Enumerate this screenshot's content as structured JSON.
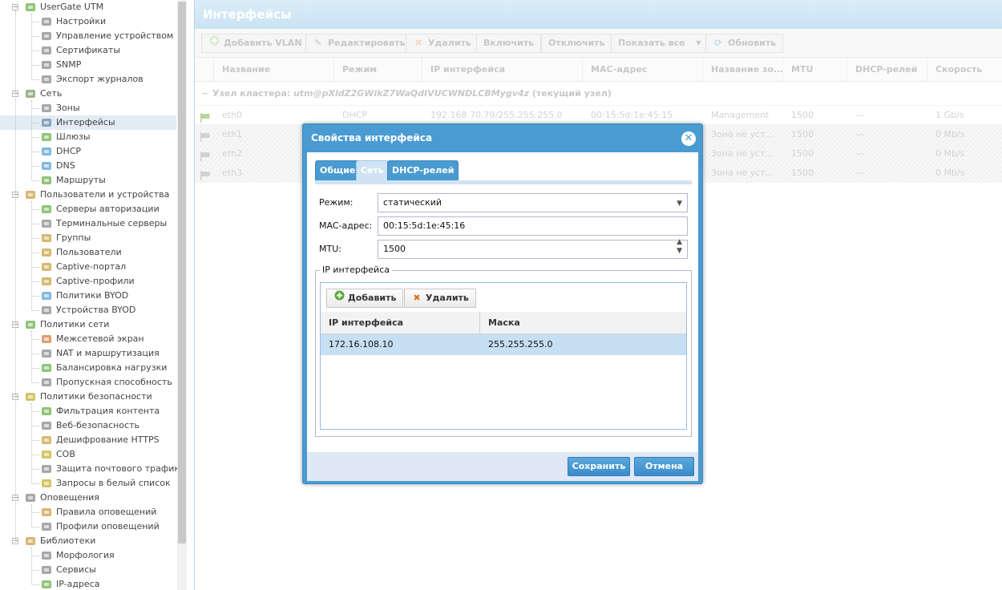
{
  "sidebar": {
    "items": [
      {
        "label": "UserGate UTM",
        "level": 0,
        "icon": "chart-icon",
        "color": "#6ab04c"
      },
      {
        "label": "Настройки",
        "level": 1,
        "icon": "settings-icon",
        "color": "#8a8a8a"
      },
      {
        "label": "Управление устройством",
        "level": 1,
        "icon": "device-icon",
        "color": "#8a8a8a"
      },
      {
        "label": "Сертификаты",
        "level": 1,
        "icon": "certificate-icon",
        "color": "#8a8a8a"
      },
      {
        "label": "SNMP",
        "level": 1,
        "icon": "snmp-icon",
        "color": "#8a8a8a"
      },
      {
        "label": "Экспорт журналов",
        "level": 1,
        "icon": "export-icon",
        "color": "#8a8a8a"
      },
      {
        "label": "Сеть",
        "level": 0,
        "icon": "network-icon",
        "color": "#7a9a6a"
      },
      {
        "label": "Зоны",
        "level": 1,
        "icon": "zones-icon",
        "color": "#8a8a8a"
      },
      {
        "label": "Интерфейсы",
        "level": 1,
        "icon": "interfaces-icon",
        "color": "#6a8aaa"
      },
      {
        "label": "Шлюзы",
        "level": 1,
        "icon": "gateway-icon",
        "color": "#6ab04c"
      },
      {
        "label": "DHCP",
        "level": 1,
        "icon": "dhcp-icon",
        "color": "#5aa0d0"
      },
      {
        "label": "DNS",
        "level": 1,
        "icon": "dns-icon",
        "color": "#5aa0d0"
      },
      {
        "label": "Маршруты",
        "level": 1,
        "icon": "routes-icon",
        "color": "#6ab04c"
      },
      {
        "label": "Пользователи и устройства",
        "level": 0,
        "icon": "users-devices-icon",
        "color": "#c8a040"
      },
      {
        "label": "Серверы авторизации",
        "level": 1,
        "icon": "auth-server-icon",
        "color": "#6ab04c"
      },
      {
        "label": "Терминальные серверы",
        "level": 1,
        "icon": "terminal-server-icon",
        "color": "#8a8a8a"
      },
      {
        "label": "Группы",
        "level": 1,
        "icon": "groups-icon",
        "color": "#c8a040"
      },
      {
        "label": "Пользователи",
        "level": 1,
        "icon": "user-icon",
        "color": "#c8a040"
      },
      {
        "label": "Captive-портал",
        "level": 1,
        "icon": "captive-portal-icon",
        "color": "#c8a040"
      },
      {
        "label": "Captive-профили",
        "level": 1,
        "icon": "captive-profile-icon",
        "color": "#c8a040"
      },
      {
        "label": "Политики BYOD",
        "level": 1,
        "icon": "byod-policy-icon",
        "color": "#5aa0d0"
      },
      {
        "label": "Устройства BYOD",
        "level": 1,
        "icon": "byod-device-icon",
        "color": "#8a8a8a"
      },
      {
        "label": "Политики сети",
        "level": 0,
        "icon": "network-policy-icon",
        "color": "#6ab04c"
      },
      {
        "label": "Межсетевой экран",
        "level": 1,
        "icon": "firewall-icon",
        "color": "#d08040"
      },
      {
        "label": "NAT и маршрутизация",
        "level": 1,
        "icon": "nat-icon",
        "color": "#8a8a8a"
      },
      {
        "label": "Балансировка нагрузки",
        "level": 1,
        "icon": "load-balance-icon",
        "color": "#6ab04c"
      },
      {
        "label": "Пропускная способность",
        "level": 1,
        "icon": "bandwidth-icon",
        "color": "#8a8a8a"
      },
      {
        "label": "Политики безопасности",
        "level": 0,
        "icon": "security-policy-icon",
        "color": "#c8b030"
      },
      {
        "label": "Фильтрация контента",
        "level": 1,
        "icon": "content-filter-icon",
        "color": "#6ab04c"
      },
      {
        "label": "Веб-безопасность",
        "level": 1,
        "icon": "web-security-icon",
        "color": "#8a8a8a"
      },
      {
        "label": "Дешифрование HTTPS",
        "level": 1,
        "icon": "https-decrypt-icon",
        "color": "#c8a040"
      },
      {
        "label": "СОВ",
        "level": 1,
        "icon": "ids-icon",
        "color": "#c8b030"
      },
      {
        "label": "Защита почтового трафика",
        "level": 1,
        "icon": "mail-protection-icon",
        "color": "#8a8a8a"
      },
      {
        "label": "Запросы в белый список",
        "level": 1,
        "icon": "whitelist-icon",
        "color": "#c8b030"
      },
      {
        "label": "Оповещения",
        "level": 0,
        "icon": "alerts-icon",
        "color": "#8a8a8a"
      },
      {
        "label": "Правила оповещений",
        "level": 1,
        "icon": "alert-rules-icon",
        "color": "#c8a040"
      },
      {
        "label": "Профили оповещений",
        "level": 1,
        "icon": "alert-profiles-icon",
        "color": "#8a8a8a"
      },
      {
        "label": "Библиотеки",
        "level": 0,
        "icon": "libraries-icon",
        "color": "#c8a040"
      },
      {
        "label": "Морфология",
        "level": 1,
        "icon": "morphology-icon",
        "color": "#8a8a8a"
      },
      {
        "label": "Сервисы",
        "level": 1,
        "icon": "services-icon",
        "color": "#8a8a8a"
      },
      {
        "label": "IP-адреса",
        "level": 1,
        "icon": "ip-addresses-icon",
        "color": "#6ab04c"
      }
    ]
  },
  "main": {
    "title": "Интерфейсы",
    "toolbar": {
      "add_vlan": "Добавить VLAN",
      "edit": "Редактировать",
      "delete": "Удалить",
      "enable": "Включить",
      "disable": "Отключить",
      "show_all": "Показать все",
      "refresh": "Обновить"
    },
    "columns": [
      "Название",
      "Режим",
      "IP интерфейса",
      "MAC-адрес",
      "Название зо...",
      "MTU",
      "DHCP-релей",
      "Скорость"
    ],
    "group": {
      "prefix": "Узел кластера:",
      "node_id": "utm@pXldZ2GWlkZ7WaQdIVUCWNDLCBMygv4z",
      "suffix": "(текущий узел)",
      "toggle": "−"
    },
    "rows": [
      {
        "name": "eth0",
        "mode": "DHCP",
        "ip": "192.168.70.79/255.255.255.0",
        "mac": "00:15:5d:1e:45:15",
        "zone": "Management",
        "mtu": "1500",
        "relay": "—",
        "speed": "1 Gb/s",
        "flag_color": "#8cc06a"
      },
      {
        "name": "eth1",
        "mode": "",
        "ip": "",
        "mac": "",
        "zone": "Зона не уст...",
        "mtu": "1500",
        "relay": "—",
        "speed": "0 Mb/s",
        "flag_color": "#b8b8b8"
      },
      {
        "name": "eth2",
        "mode": "",
        "ip": "",
        "mac": "",
        "zone": "Зона не уст...",
        "mtu": "1500",
        "relay": "—",
        "speed": "0 Mb/s",
        "flag_color": "#b8b8b8"
      },
      {
        "name": "eth3",
        "mode": "",
        "ip": "",
        "mac": "",
        "zone": "Зона не уст...",
        "mtu": "1500",
        "relay": "—",
        "speed": "0 Mb/s",
        "flag_color": "#b8b8b8"
      }
    ]
  },
  "dialog": {
    "title": "Свойства интерфейса",
    "close_glyph": "✕",
    "tabs": [
      "Общие",
      "Сеть",
      "DHCP-релей"
    ],
    "active_tab": "Сеть",
    "mode_label": "Режим:",
    "mode_value": "статический",
    "mac_label": "MAC-адрес:",
    "mac_value": "00:15:5d:1e:45:16",
    "mtu_label": "MTU:",
    "mtu_value": "1500",
    "ip_section": {
      "legend": "IP интерфейса",
      "add": "Добавить",
      "delete": "Удалить",
      "columns": [
        "IP интерфейса",
        "Маска"
      ],
      "rows": [
        {
          "ip": "172.16.108.10",
          "mask": "255.255.255.0"
        }
      ]
    },
    "save": "Сохранить",
    "cancel": "Отмена"
  }
}
